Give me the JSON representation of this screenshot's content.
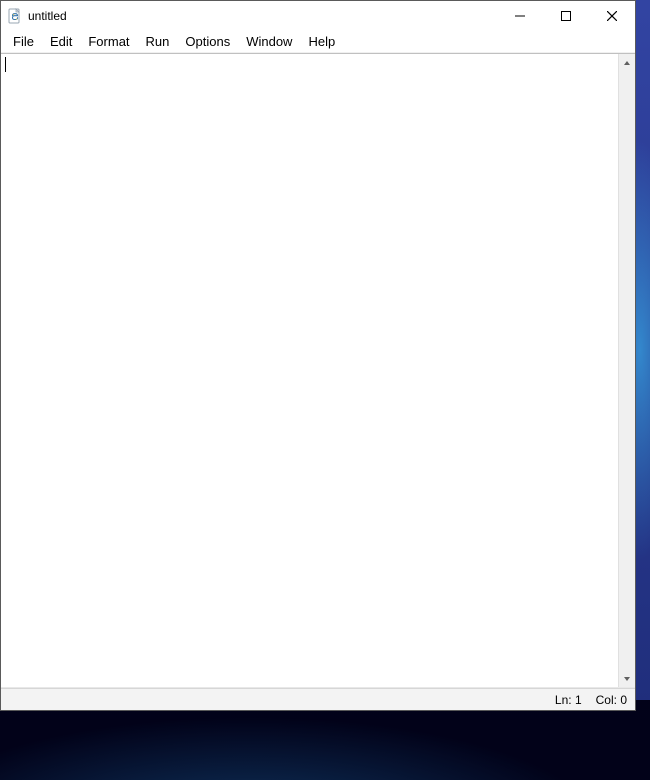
{
  "window": {
    "title": "untitled"
  },
  "menu": {
    "items": [
      "File",
      "Edit",
      "Format",
      "Run",
      "Options",
      "Window",
      "Help"
    ]
  },
  "editor": {
    "content": ""
  },
  "status": {
    "line_label": "Ln:",
    "line_value": "1",
    "col_label": "Col:",
    "col_value": "0"
  }
}
